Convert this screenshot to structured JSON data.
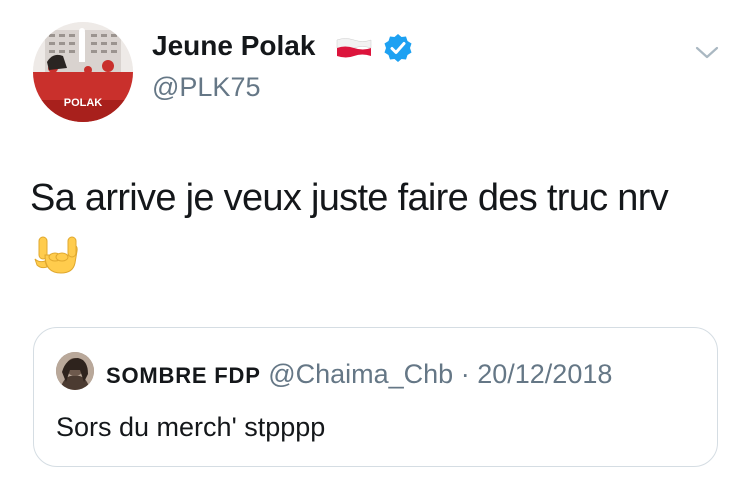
{
  "author": {
    "name": "Jeune Polak",
    "handle": "@PLK75",
    "avatar_text": "POLAK",
    "flag_icon": "poland-flag-icon",
    "verified_icon": "verified-badge-icon",
    "verified_color": "#1da1f2"
  },
  "tweet": {
    "text": "Sa arrive je veux juste faire des truc nrv",
    "emoji_icon": "sign-of-the-horns-icon"
  },
  "quoted_tweet": {
    "name": "SOMBRE FDP",
    "handle": "@Chaima_Chb",
    "separator": "·",
    "date": "20/12/2018",
    "text": "Sors du merch' stpppp"
  },
  "menu_icon": "chevron-down-icon"
}
